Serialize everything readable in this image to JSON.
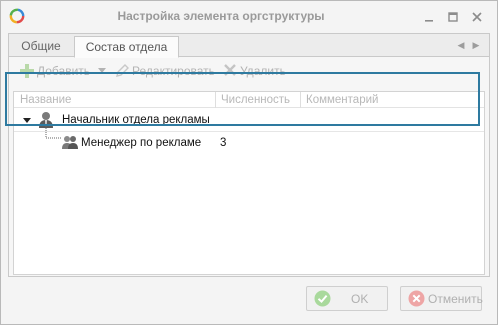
{
  "window": {
    "title": "Настройка элемента оргструктуры",
    "minimize_icon": "minimize-icon",
    "maximize_icon": "maximize-icon",
    "close_icon": "close-icon"
  },
  "tabs": [
    {
      "label": "Общие",
      "active": false
    },
    {
      "label": "Состав отдела",
      "active": true
    }
  ],
  "toolbar": {
    "add_label": "Добавить",
    "edit_label": "Редактировать",
    "delete_label": "Удалить"
  },
  "grid": {
    "columns": [
      "Название",
      "Численность",
      "Комментарий"
    ],
    "rows": [
      {
        "name": "Начальник отдела рекламы",
        "count": "",
        "comment": ""
      },
      {
        "name": "Менеджер по рекламе",
        "count": "3",
        "comment": ""
      }
    ]
  },
  "footer": {
    "ok_label": "OK",
    "cancel_label": "Отменить"
  },
  "colors": {
    "highlight": "#2e7aa0",
    "ok_icon": "#7cc26f",
    "cancel_icon": "#e06b6b"
  }
}
